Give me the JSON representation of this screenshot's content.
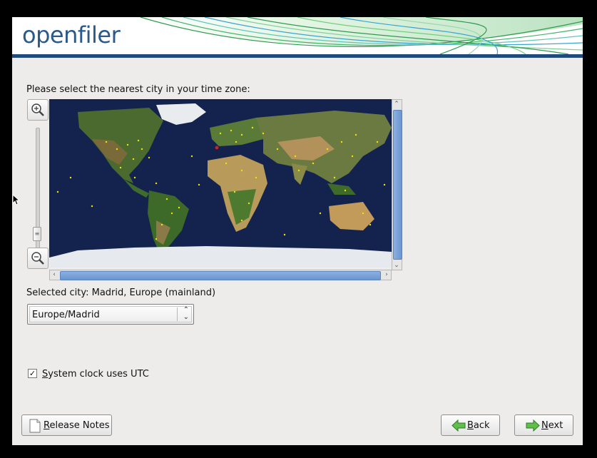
{
  "branding": {
    "logo_text": "openfiler",
    "accent": "#1f4a7c"
  },
  "timezone": {
    "prompt": "Please select the nearest city in your time zone:",
    "selected_city_label": "Selected city: Madrid, Europe (mainland)",
    "select_value": "Europe/Madrid"
  },
  "clock": {
    "utc_label_first": "S",
    "utc_label_rest": "ystem clock uses UTC",
    "checked": true
  },
  "buttons": {
    "release_first": "R",
    "release_rest": "elease Notes",
    "back_first": "B",
    "back_rest": "ack",
    "next_first": "N",
    "next_rest": "ext"
  },
  "map": {
    "selected_marker_color": "#d02020",
    "city_dot_color": "#f2e400"
  },
  "icons": [
    "zoom-in-icon",
    "zoom-out-icon",
    "document-icon",
    "back-arrow-icon",
    "next-arrow-icon",
    "checkbox-checked-icon",
    "mouse-pointer-icon"
  ]
}
